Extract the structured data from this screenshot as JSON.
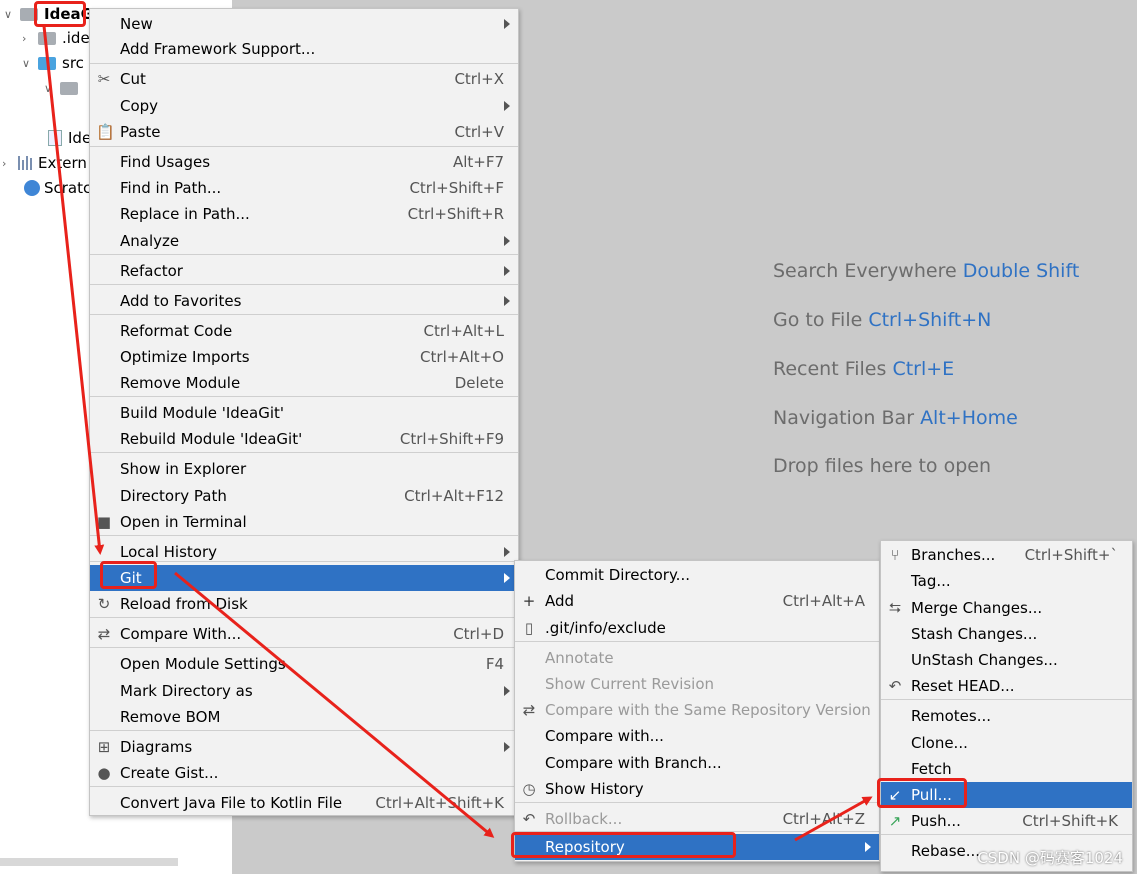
{
  "tree": {
    "root": "IdeaG",
    "items": [
      ".ide",
      "src",
      "",
      "Ide",
      "Extern",
      "Scratc"
    ]
  },
  "hints": [
    {
      "text": "Search Everywhere",
      "key": "Double Shift"
    },
    {
      "text": "Go to File",
      "key": "Ctrl+Shift+N"
    },
    {
      "text": "Recent Files",
      "key": "Ctrl+E"
    },
    {
      "text": "Navigation Bar",
      "key": "Alt+Home"
    },
    {
      "text": "Drop files here to open",
      "key": ""
    }
  ],
  "context_menu": [
    {
      "label": "New",
      "shortcut": "",
      "submenu": true
    },
    {
      "label": "Add Framework Support...",
      "shortcut": ""
    },
    {
      "label": "Cut",
      "shortcut": "Ctrl+X",
      "icon": "scissors-icon"
    },
    {
      "label": "Copy",
      "shortcut": "",
      "submenu": true
    },
    {
      "label": "Paste",
      "shortcut": "Ctrl+V",
      "icon": "clipboard-icon"
    },
    {
      "label": "Find Usages",
      "shortcut": "Alt+F7"
    },
    {
      "label": "Find in Path...",
      "shortcut": "Ctrl+Shift+F"
    },
    {
      "label": "Replace in Path...",
      "shortcut": "Ctrl+Shift+R"
    },
    {
      "label": "Analyze",
      "shortcut": "",
      "submenu": true
    },
    {
      "label": "Refactor",
      "shortcut": "",
      "submenu": true
    },
    {
      "label": "Add to Favorites",
      "shortcut": "",
      "submenu": true
    },
    {
      "label": "Reformat Code",
      "shortcut": "Ctrl+Alt+L"
    },
    {
      "label": "Optimize Imports",
      "shortcut": "Ctrl+Alt+O"
    },
    {
      "label": "Remove Module",
      "shortcut": "Delete"
    },
    {
      "label": "Build Module 'IdeaGit'",
      "shortcut": ""
    },
    {
      "label": "Rebuild Module 'IdeaGit'",
      "shortcut": "Ctrl+Shift+F9"
    },
    {
      "label": "Show in Explorer",
      "shortcut": ""
    },
    {
      "label": "Directory Path",
      "shortcut": "Ctrl+Alt+F12"
    },
    {
      "label": "Open in Terminal",
      "shortcut": "",
      "icon": "terminal-icon"
    },
    {
      "label": "Local History",
      "shortcut": "",
      "submenu": true
    },
    {
      "label": "Git",
      "shortcut": "",
      "submenu": true,
      "selected": true
    },
    {
      "label": "Reload from Disk",
      "shortcut": "",
      "icon": "reload-icon"
    },
    {
      "label": "Compare With...",
      "shortcut": "Ctrl+D",
      "icon": "compare-icon"
    },
    {
      "label": "Open Module Settings",
      "shortcut": "F4"
    },
    {
      "label": "Mark Directory as",
      "shortcut": "",
      "submenu": true
    },
    {
      "label": "Remove BOM",
      "shortcut": ""
    },
    {
      "label": "Diagrams",
      "shortcut": "",
      "submenu": true,
      "icon": "diagram-icon"
    },
    {
      "label": "Create Gist...",
      "shortcut": "",
      "icon": "github-icon"
    },
    {
      "label": "Convert Java File to Kotlin File",
      "shortcut": "Ctrl+Alt+Shift+K"
    }
  ],
  "git_menu": [
    {
      "label": "Commit Directory...",
      "shortcut": ""
    },
    {
      "label": "Add",
      "shortcut": "Ctrl+Alt+A",
      "icon": "plus-icon"
    },
    {
      "label": ".git/info/exclude",
      "shortcut": "",
      "icon": "file-icon"
    },
    {
      "label": "Annotate",
      "shortcut": "",
      "disabled": true
    },
    {
      "label": "Show Current Revision",
      "shortcut": "",
      "disabled": true
    },
    {
      "label": "Compare with the Same Repository Version",
      "shortcut": "",
      "disabled": true,
      "icon": "compare-icon"
    },
    {
      "label": "Compare with...",
      "shortcut": ""
    },
    {
      "label": "Compare with Branch...",
      "shortcut": ""
    },
    {
      "label": "Show History",
      "shortcut": "",
      "icon": "clock-icon"
    },
    {
      "label": "Rollback...",
      "shortcut": "Ctrl+Alt+Z",
      "disabled": true,
      "icon": "undo-icon"
    },
    {
      "label": "Repository",
      "shortcut": "",
      "submenu": true,
      "selected": true
    }
  ],
  "repo_menu": [
    {
      "label": "Branches...",
      "shortcut": "Ctrl+Shift+`",
      "icon": "branch-icon"
    },
    {
      "label": "Tag...",
      "shortcut": ""
    },
    {
      "label": "Merge Changes...",
      "shortcut": "",
      "icon": "merge-icon"
    },
    {
      "label": "Stash Changes...",
      "shortcut": ""
    },
    {
      "label": "UnStash Changes...",
      "shortcut": ""
    },
    {
      "label": "Reset HEAD...",
      "shortcut": "",
      "icon": "undo-icon"
    },
    {
      "label": "Remotes...",
      "shortcut": ""
    },
    {
      "label": "Clone...",
      "shortcut": ""
    },
    {
      "label": "Fetch",
      "shortcut": ""
    },
    {
      "label": "Pull...",
      "shortcut": "",
      "selected": true,
      "icon": "pull-icon"
    },
    {
      "label": "Push...",
      "shortcut": "Ctrl+Shift+K",
      "icon": "push-icon"
    },
    {
      "label": "Rebase...",
      "shortcut": ""
    }
  ],
  "watermark": "CSDN @码赛客1024",
  "colors": {
    "selection": "#2f72c4",
    "annotation": "#e8221b",
    "editor_bg": "#cacaca"
  }
}
